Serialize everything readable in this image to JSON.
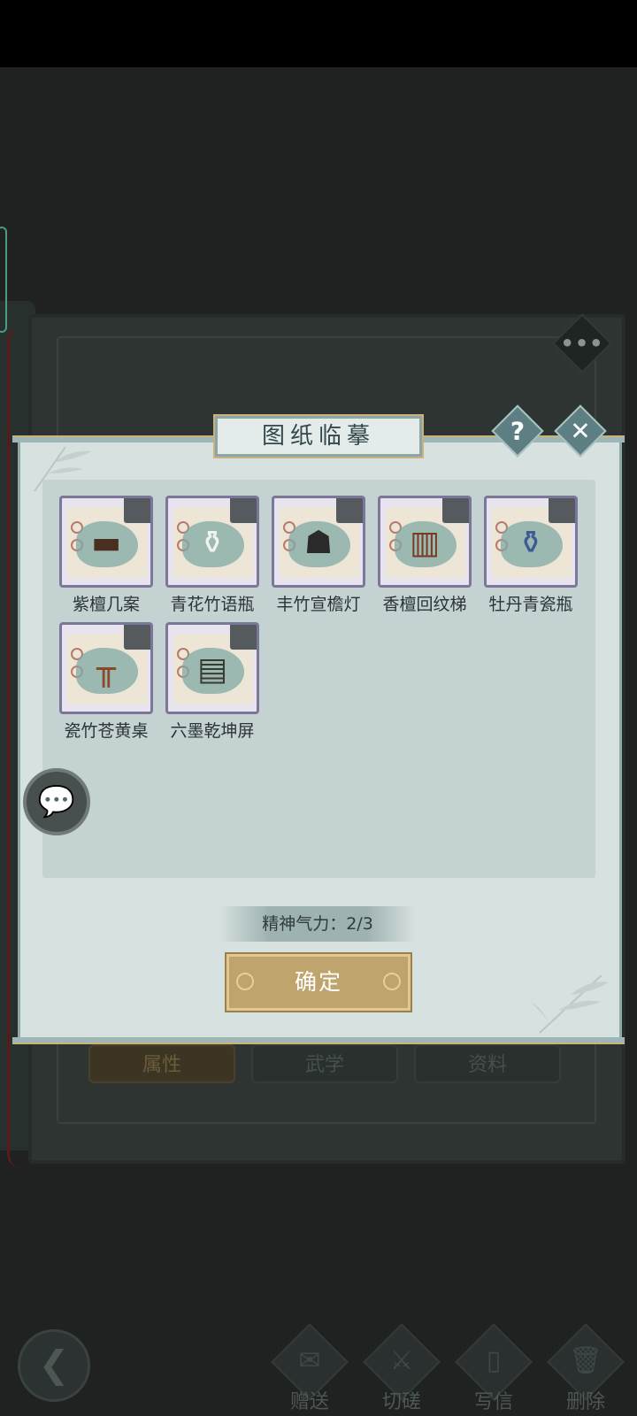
{
  "dialog": {
    "title": "图纸临摹",
    "help_icon": "?",
    "close_icon": "✕",
    "energy_text": "精神气力：2/3",
    "confirm_label": "确定"
  },
  "items": [
    {
      "name": "紫檀几案",
      "icon": "low-table-icon"
    },
    {
      "name": "青花竹语瓶",
      "icon": "vase-icon"
    },
    {
      "name": "丰竹宣檐灯",
      "icon": "lantern-icon"
    },
    {
      "name": "香檀回纹梯",
      "icon": "wood-stand-icon"
    },
    {
      "name": "牡丹青瓷瓶",
      "icon": "porcelain-vase-icon"
    },
    {
      "name": "瓷竹苍黄桌",
      "icon": "table-icon"
    },
    {
      "name": "六墨乾坤屏",
      "icon": "folding-screen-icon"
    }
  ],
  "background": {
    "tabs": [
      "属性",
      "武学",
      "资料"
    ]
  },
  "bottom_nav": [
    {
      "label": "赠送",
      "icon": "scroll-icon"
    },
    {
      "label": "切磋",
      "icon": "sword-icon"
    },
    {
      "label": "写信",
      "icon": "letter-icon"
    },
    {
      "label": "删除",
      "icon": "trash-icon"
    }
  ],
  "colors": {
    "dialog_bg": "#d7e1e0",
    "panel_bg": "#c4d3d2",
    "confirm_bg": "#c0a46d",
    "thumb_border": "#7c7698"
  }
}
